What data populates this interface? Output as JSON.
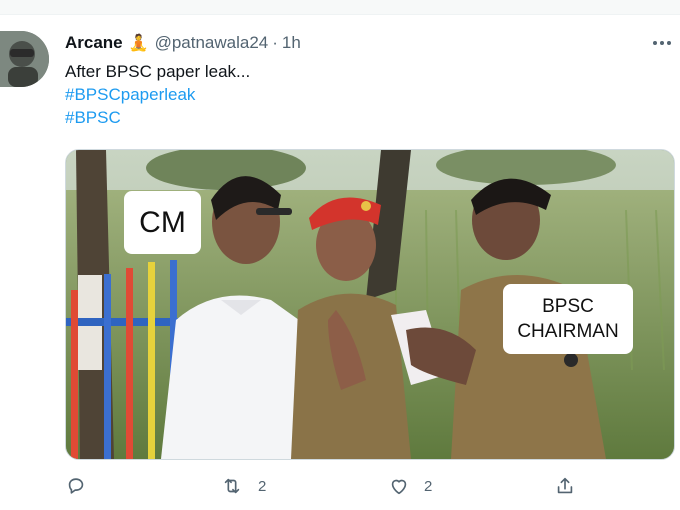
{
  "tweet": {
    "display_name": "Arcane",
    "badge_emoji": "🧘",
    "handle": "@patnawala24",
    "separator": "·",
    "time": "1h",
    "text_line": "After BPSC paper leak...",
    "hashtags": [
      "#BPSCpaperleak",
      "#BPSC"
    ]
  },
  "meme": {
    "label_left": "CM",
    "label_right_line1": "BPSC",
    "label_right_line2": "CHAIRMAN"
  },
  "actions": {
    "reply_icon": "reply-icon",
    "retweet_icon": "retweet-icon",
    "retweet_count": "2",
    "like_icon": "heart-icon",
    "like_count": "2",
    "share_icon": "share-icon"
  },
  "colors": {
    "link": "#1d9bf0",
    "secondary_text": "#536471",
    "beret_red": "#d3342c",
    "uniform_khaki": "#8a7348"
  }
}
